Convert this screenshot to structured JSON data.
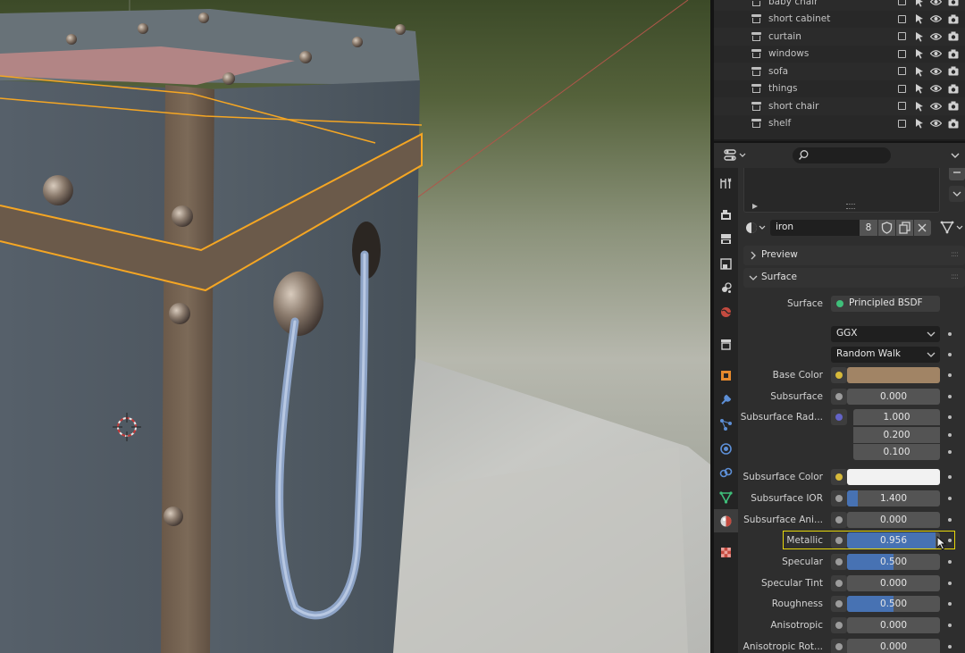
{
  "outliner": {
    "items": [
      {
        "name": "baby chair"
      },
      {
        "name": "short cabinet"
      },
      {
        "name": "curtain"
      },
      {
        "name": "windows"
      },
      {
        "name": "sofa"
      },
      {
        "name": "things"
      },
      {
        "name": "short chair"
      },
      {
        "name": "shelf"
      }
    ]
  },
  "material": {
    "name": "iron",
    "users": "8"
  },
  "panels": {
    "preview": "Preview",
    "surface": "Surface"
  },
  "surface": {
    "label": "Surface",
    "shader": "Principled BSDF",
    "distribution": "GGX",
    "subsurface_method": "Random Walk",
    "fields": [
      {
        "label": "Base Color",
        "type": "color",
        "color": "#a18465",
        "socket": "#d6b93a"
      },
      {
        "label": "Subsurface",
        "type": "value",
        "value": "0.000",
        "fraction": 0,
        "socket": "#9c9c9c"
      },
      {
        "label": "Subsurface Rad...",
        "type": "vector",
        "values": [
          "1.000",
          "0.200",
          "0.100"
        ],
        "socket": "#6363c7"
      },
      {
        "label": "Subsurface Color",
        "type": "color",
        "color": "#f2f2f2",
        "socket": "#d6b93a"
      },
      {
        "label": "Subsurface IOR",
        "type": "value",
        "value": "1.400",
        "fraction": 0.12,
        "socket": "#9c9c9c"
      },
      {
        "label": "Subsurface Ani...",
        "type": "value",
        "value": "0.000",
        "fraction": 0,
        "socket": "#9c9c9c"
      },
      {
        "label": "Metallic",
        "type": "value",
        "value": "0.956",
        "fraction": 0.956,
        "socket": "#9c9c9c",
        "highlighted": true
      },
      {
        "label": "Specular",
        "type": "value",
        "value": "0.500",
        "fraction": 0.5,
        "socket": "#9c9c9c"
      },
      {
        "label": "Specular Tint",
        "type": "value",
        "value": "0.000",
        "fraction": 0,
        "socket": "#9c9c9c"
      },
      {
        "label": "Roughness",
        "type": "value",
        "value": "0.500",
        "fraction": 0.5,
        "socket": "#9c9c9c"
      },
      {
        "label": "Anisotropic",
        "type": "value",
        "value": "0.000",
        "fraction": 0,
        "socket": "#9c9c9c"
      },
      {
        "label": "Anisotropic Rot...",
        "type": "value",
        "value": "0.000",
        "fraction": 0,
        "socket": "#9c9c9c"
      }
    ]
  },
  "colors": {
    "accent": "#4772b3",
    "selection_outline": "#f5a623",
    "highlight_box": "#e8d80a"
  },
  "icons": {
    "properties_tabs": [
      "tool-icon",
      "render-icon",
      "output-icon",
      "view-layer-icon",
      "scene-icon",
      "world-icon",
      "collection-icon",
      "object-icon",
      "modifier-icon",
      "particles-icon",
      "physics-icon",
      "constraints-icon",
      "object-data-icon",
      "material-icon",
      "texture-icon"
    ]
  }
}
